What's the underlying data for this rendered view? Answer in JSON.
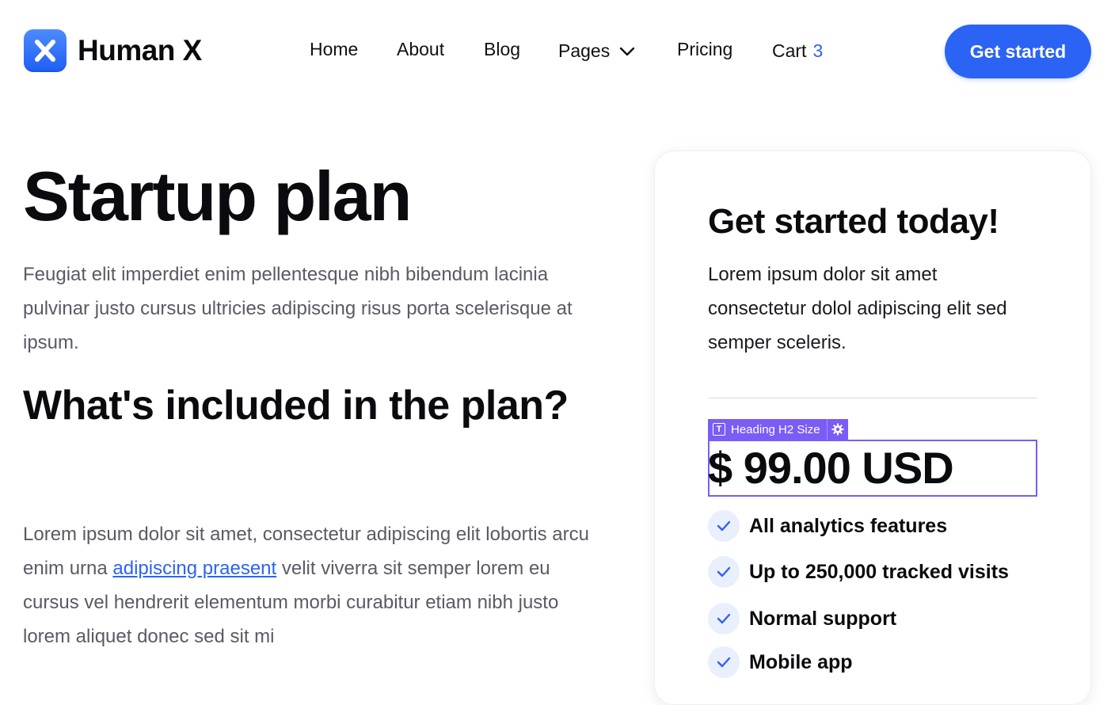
{
  "nav": {
    "brand": "Human X",
    "links": [
      "Home",
      "About",
      "Blog",
      "Pages",
      "Pricing"
    ],
    "cart_label": "Cart",
    "cart_count": "3",
    "cta": "Get started"
  },
  "hero": {
    "title": "Startup plan",
    "description": "Feugiat elit imperdiet enim pellentesque nibh bibendum lacinia pulvinar justo cursus ultricies adipiscing risus porta scelerisque at ipsum."
  },
  "included": {
    "title": "What's included in the plan?",
    "text_before_link": "Lorem ipsum dolor sit amet, consectetur adipiscing elit lobortis arcu enim urna ",
    "link_text": "adipiscing praesent",
    "text_after_link": " velit viverra sit semper lorem eu cursus vel hendrerit elementum morbi curabitur etiam nibh justo lorem aliquet donec sed sit mi"
  },
  "card": {
    "title": "Get started today!",
    "description": "Lorem ipsum dolor sit amet consectetur dolol adipiscing elit sed semper sceleris.",
    "editor_tag": "Heading H2 Size",
    "price": "$ 99.00 USD",
    "features": [
      "All analytics features",
      "Up to 250,000 tracked visits",
      "Normal support",
      "Mobile app"
    ]
  },
  "colors": {
    "primary": "#2b63f5",
    "editor_accent": "#7b5cf6",
    "text_muted": "#5a5a66"
  }
}
